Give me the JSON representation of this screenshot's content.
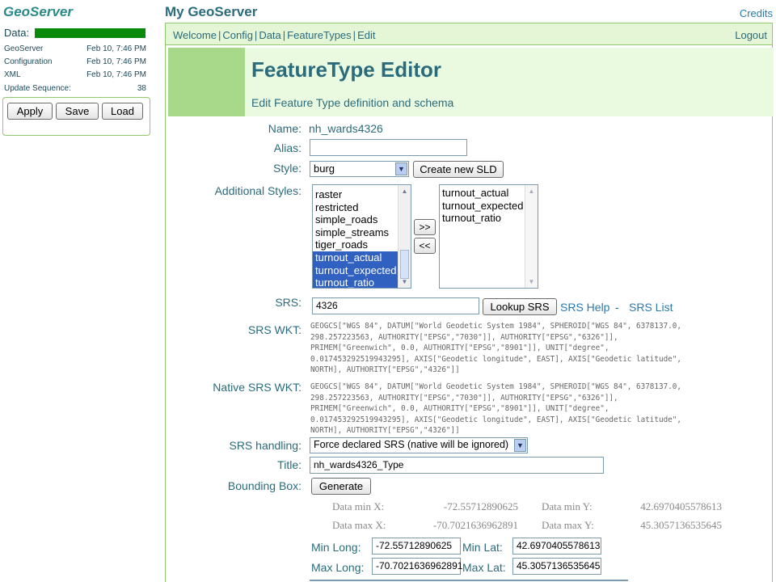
{
  "sidebar": {
    "logo": "GeoServer",
    "data_label": "Data:",
    "stats": [
      {
        "label": "GeoServer",
        "value": "Feb 10, 7:46 PM"
      },
      {
        "label": "Configuration",
        "value": "Feb 10, 7:46 PM"
      },
      {
        "label": "XML",
        "value": "Feb 10, 7:46 PM"
      },
      {
        "label": "Update Sequence:",
        "value": "38"
      }
    ],
    "buttons": {
      "apply": "Apply",
      "save": "Save",
      "load": "Load"
    }
  },
  "header": {
    "title": "My GeoServer",
    "credits": "Credits",
    "nav": [
      "Welcome",
      "Config",
      "Data",
      "FeatureTypes",
      "Edit"
    ],
    "logout": "Logout"
  },
  "page": {
    "title": "FeatureType Editor",
    "subtitle": "Edit Feature Type definition and schema"
  },
  "form": {
    "name_label": "Name:",
    "name_value": "nh_wards4326",
    "alias_label": "Alias:",
    "alias_value": "",
    "style_label": "Style:",
    "style_value": "burg",
    "create_sld": "Create new SLD",
    "additional_styles_label": "Additional Styles:",
    "available_styles": [
      {
        "name": "raster",
        "selected": false
      },
      {
        "name": "restricted",
        "selected": false
      },
      {
        "name": "simple_roads",
        "selected": false
      },
      {
        "name": "simple_streams",
        "selected": false
      },
      {
        "name": "tiger_roads",
        "selected": false
      },
      {
        "name": "turnout_actual",
        "selected": true
      },
      {
        "name": "turnout_expected",
        "selected": true
      },
      {
        "name": "turnout_ratio",
        "selected": true
      }
    ],
    "add_button": ">>",
    "remove_button": "<<",
    "chosen_styles": [
      "turnout_actual",
      "turnout_expected",
      "turnout_ratio"
    ],
    "srs_label": "SRS:",
    "srs_value": "4326",
    "lookup_srs": "Lookup SRS",
    "srs_help": "SRS Help",
    "srs_dash": "-",
    "srs_list": "SRS List",
    "srs_wkt_label": "SRS WKT:",
    "srs_wkt": "GEOGCS[\"WGS 84\", DATUM[\"World Geodetic System 1984\", SPHEROID[\"WGS 84\", 6378137.0,\n298.257223563, AUTHORITY[\"EPSG\",\"7030\"]], AUTHORITY[\"EPSG\",\"6326\"]],\nPRIMEM[\"Greenwich\", 0.0, AUTHORITY[\"EPSG\",\"8901\"]], UNIT[\"degree\",\n0.017453292519943295], AXIS[\"Geodetic longitude\", EAST], AXIS[\"Geodetic latitude\",\nNORTH], AUTHORITY[\"EPSG\",\"4326\"]]",
    "native_wkt_label": "Native SRS WKT:",
    "native_wkt": "GEOGCS[\"WGS 84\", DATUM[\"World Geodetic System 1984\", SPHEROID[\"WGS 84\", 6378137.0,\n298.257223563, AUTHORITY[\"EPSG\",\"7030\"]], AUTHORITY[\"EPSG\",\"6326\"]],\nPRIMEM[\"Greenwich\", 0.0, AUTHORITY[\"EPSG\",\"8901\"]], UNIT[\"degree\",\n0.017453292519943295], AXIS[\"Geodetic longitude\", EAST], AXIS[\"Geodetic latitude\",\nNORTH], AUTHORITY[\"EPSG\",\"4326\"]]",
    "srs_handling_label": "SRS handling:",
    "srs_handling_value": "Force declared SRS (native will be ignored)",
    "title_label": "Title:",
    "title_value": "nh_wards4326_Type",
    "bbox_label": "Bounding Box:",
    "generate": "Generate",
    "data_min_x_label": "Data min X:",
    "data_min_x": "-72.55712890625",
    "data_min_y_label": "Data min Y:",
    "data_min_y": "42.6970405578613",
    "data_max_x_label": "Data max X:",
    "data_max_x": "-70.7021636962891",
    "data_max_y_label": "Data max Y:",
    "data_max_y": "45.3057136535645",
    "min_long_label": "Min Long:",
    "min_long": "-72.55712890625",
    "min_lat_label": "Min Lat:",
    "min_lat": "42.6970405578613",
    "max_long_label": "Max Long:",
    "max_long": "-70.7021636962891",
    "max_lat_label": "Max Lat:",
    "max_lat": "45.3057136535645"
  },
  "colors": {
    "accent": "#2a6b7c",
    "nav_bg": "#e4f6d6",
    "border": "#8fc86f",
    "data_bar": "#0a8a0a"
  }
}
